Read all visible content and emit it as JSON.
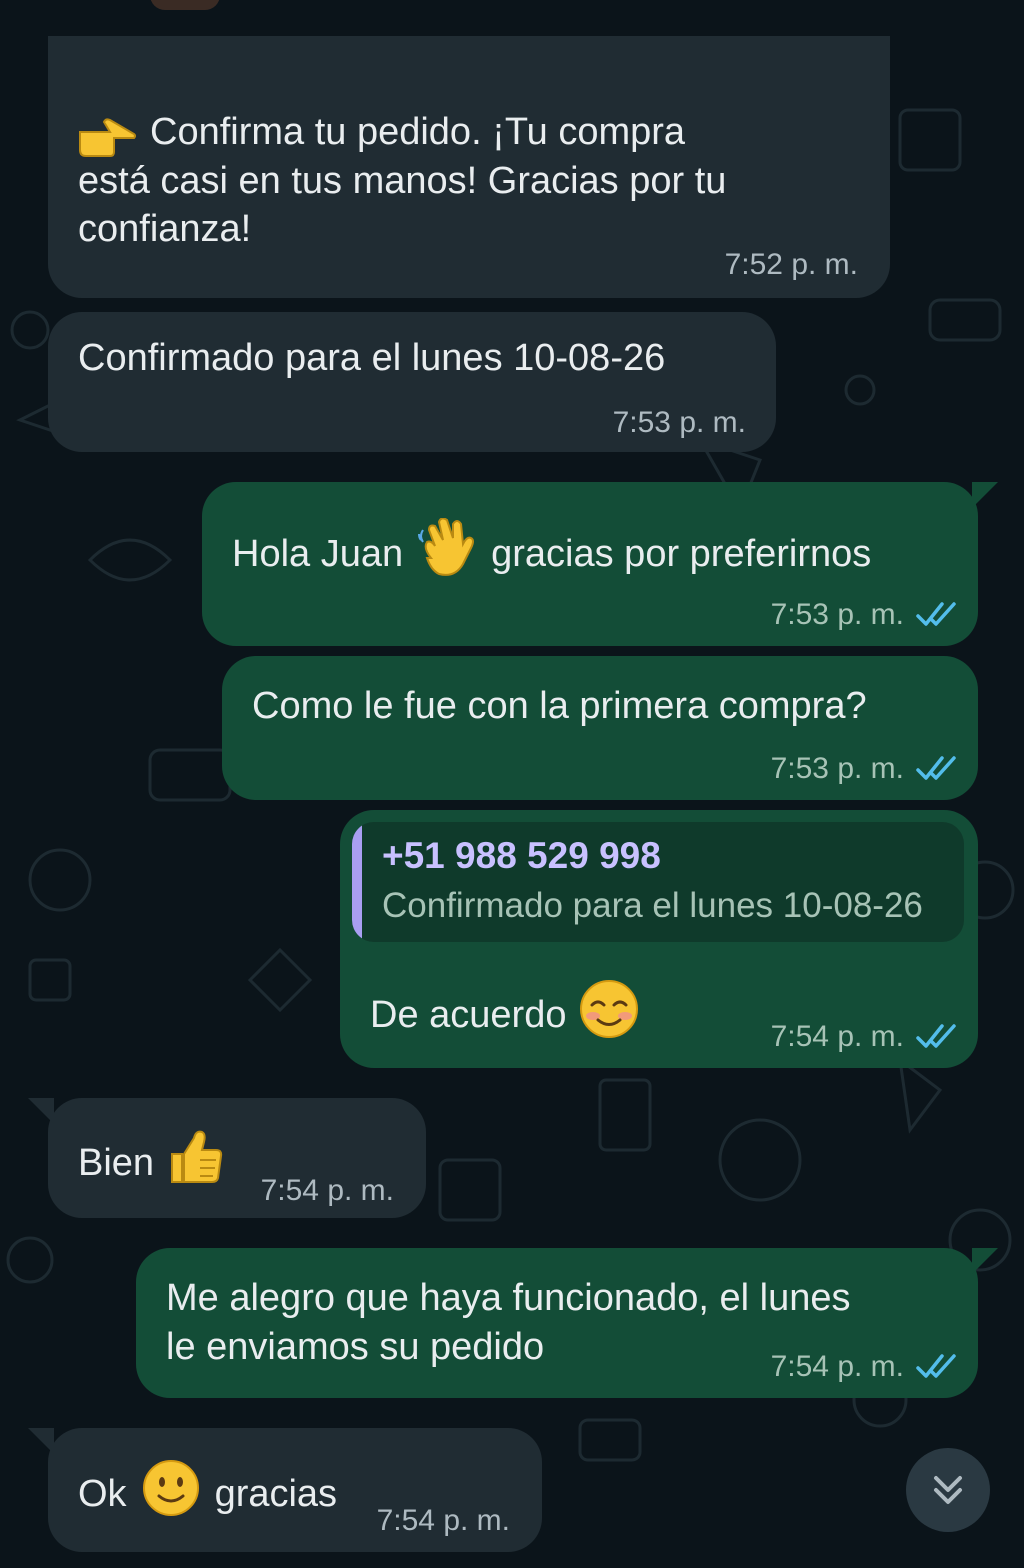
{
  "colors": {
    "background": "#0b141a",
    "incoming_bubble": "#202c33",
    "outgoing_bubble": "#134d37",
    "read_ticks": "#53bdeb",
    "quote_accent": "#a99ff2"
  },
  "messages": [
    {
      "direction": "incoming",
      "text": "Confirma tu pedido. ¡Tu compra\nestá casi en tus manos! Gracias por tu\nconfianza!",
      "emoji": "pointing-right-emoji",
      "time": "7:52 p. m."
    },
    {
      "direction": "incoming",
      "text": "Confirmado para el lunes 10-08-26",
      "time": "7:53 p. m."
    },
    {
      "direction": "outgoing",
      "text_before": "Hola Juan",
      "emoji": "waving-hand-emoji",
      "text_after": "gracias por preferirnos",
      "time": "7:53 p. m.",
      "status": "read"
    },
    {
      "direction": "outgoing",
      "text": "Como le fue con la primera compra?",
      "time": "7:53 p. m.",
      "status": "read"
    },
    {
      "direction": "outgoing",
      "quoted_author": "+51 988 529 998",
      "quoted_text": "Confirmado para el lunes 10-08-26",
      "text": "De acuerdo",
      "emoji": "smiling-blush-emoji",
      "time": "7:54 p. m.",
      "status": "read"
    },
    {
      "direction": "incoming",
      "text": "Bien",
      "emoji": "thumbs-up-emoji",
      "time": "7:54 p. m."
    },
    {
      "direction": "outgoing",
      "text": "Me alegro que haya funcionado, el lunes\nle enviamos su pedido",
      "time": "7:54 p. m.",
      "status": "read"
    },
    {
      "direction": "incoming",
      "text_before": "Ok",
      "emoji": "slightly-smiling-emoji",
      "text_after": "gracias",
      "time": "7:54 p. m."
    }
  ],
  "scroll_button": {
    "icon": "double-chevron-down-icon"
  }
}
